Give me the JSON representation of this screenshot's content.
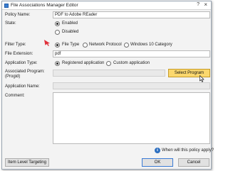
{
  "window": {
    "title": "File Associations Manager Editor",
    "help": "?",
    "close": "×"
  },
  "form": {
    "policy_name_label": "Policy Name:",
    "policy_name_value": "PDF to Adobe REader",
    "state_label": "State:",
    "state_options": [
      {
        "label": "Enabled",
        "checked": true
      },
      {
        "label": "Disabled",
        "checked": false
      }
    ],
    "filter_type_label": "Filter Type:",
    "filter_type_options": [
      {
        "label": "File Type",
        "checked": true
      },
      {
        "label": "Network Protocol",
        "checked": false
      },
      {
        "label": "Windows 10 Category",
        "checked": false
      }
    ],
    "file_extension_label": "File Extension:",
    "file_extension_value": "pdf",
    "application_type_label": "Application Type:",
    "application_type_options": [
      {
        "label": "Registered application",
        "checked": true
      },
      {
        "label": "Custom application",
        "checked": false
      }
    ],
    "associated_program_label_line1": "Associated Program:",
    "associated_program_label_line2": "(Progid)",
    "associated_program_value": "",
    "select_program_label": "Select Program",
    "application_name_label": "Application Name:",
    "application_name_value": "",
    "comment_label": "Comment:",
    "comment_value": ""
  },
  "footer": {
    "info_icon": "i",
    "info_text": "When will this policy apply?",
    "item_level_targeting_label": "Item Level Targeting",
    "ok_label": "OK",
    "cancel_label": "Cancel"
  },
  "colors": {
    "select_program_button": "#fbd86e",
    "annotation_arrow": "#e0303a",
    "info_icon": "#2d6fc0"
  },
  "icons": {
    "app": "window-app-icon",
    "annotation": "red-arrow-icon",
    "cursor": "mouse-pointer-icon",
    "info": "info-icon"
  }
}
